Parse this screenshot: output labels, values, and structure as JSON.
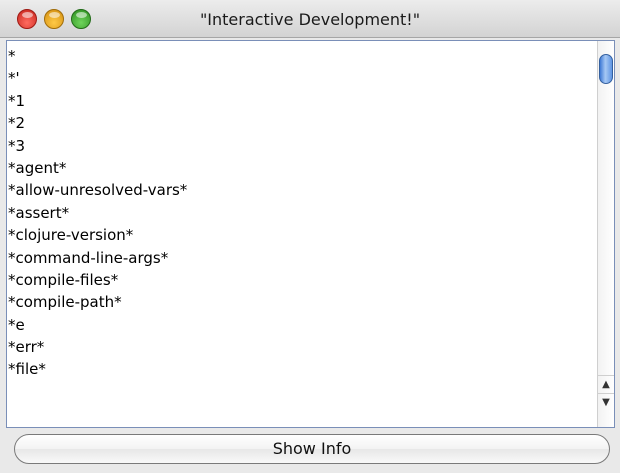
{
  "window": {
    "title": "\"Interactive Development!\""
  },
  "list": {
    "items": [
      "*",
      "*'",
      "*1",
      "*2",
      "*3",
      "*agent*",
      "*allow-unresolved-vars*",
      "*assert*",
      "*clojure-version*",
      "*command-line-args*",
      "*compile-files*",
      "*compile-path*",
      "*e",
      "*err*",
      "*file*"
    ]
  },
  "buttons": {
    "show_info_label": "Show Info"
  },
  "colors": {
    "accent": "#3f7ad6",
    "close": "#ff5f57",
    "minimize": "#ffbd2e",
    "maximize": "#28c940"
  }
}
